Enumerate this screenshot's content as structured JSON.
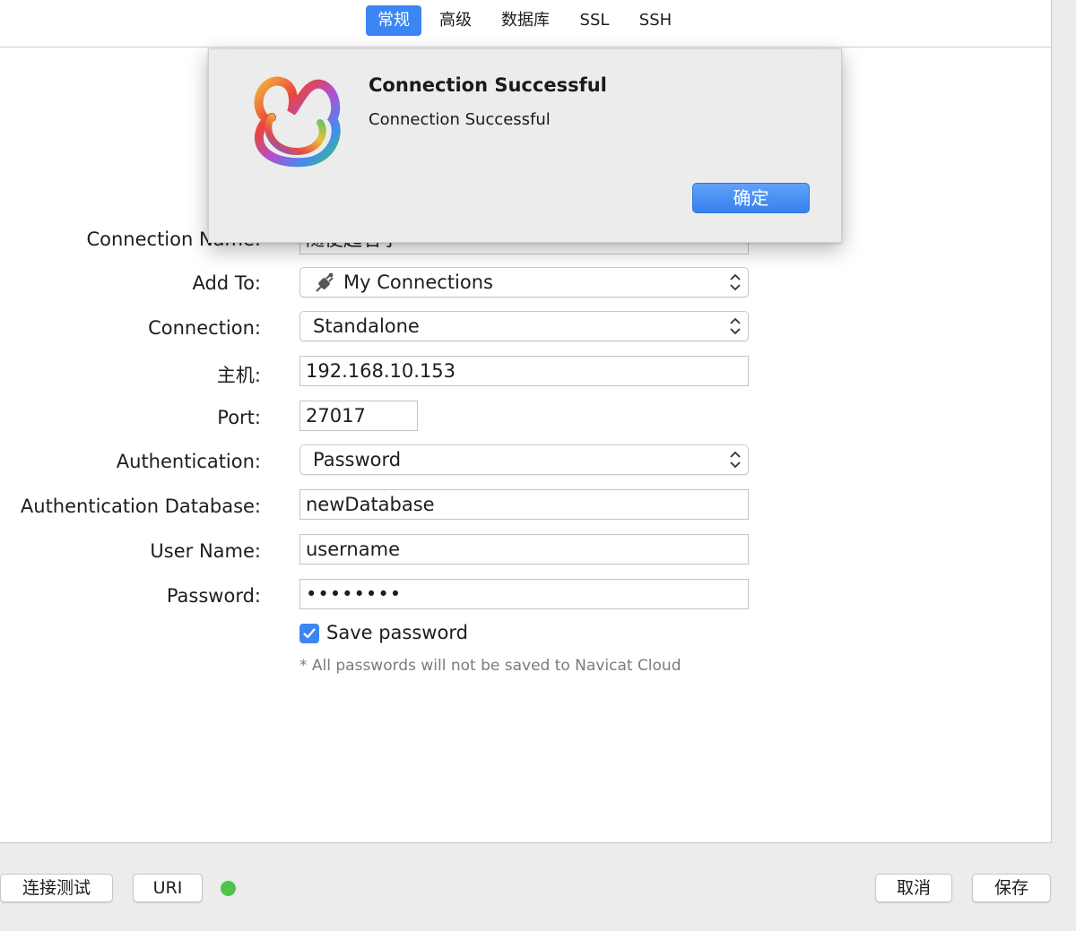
{
  "tabs": [
    {
      "label": "常规",
      "active": true
    },
    {
      "label": "高级",
      "active": false
    },
    {
      "label": "数据库",
      "active": false
    },
    {
      "label": "SSL",
      "active": false
    },
    {
      "label": "SSH",
      "active": false
    }
  ],
  "form": {
    "connection_name_label": "Connection Name:",
    "connection_name_value": "随便起名字",
    "add_to_label": "Add To:",
    "add_to_value": "My Connections",
    "connection_label": "Connection:",
    "connection_value": "Standalone",
    "host_label": "主机:",
    "host_value": "192.168.10.153",
    "port_label": "Port:",
    "port_value": "27017",
    "auth_label": "Authentication:",
    "auth_value": "Password",
    "auth_db_label": "Authentication Database:",
    "auth_db_value": "newDatabase",
    "username_label": "User Name:",
    "username_value": "username",
    "password_label": "Password:",
    "password_value": "••••••••",
    "save_password_label": "Save password",
    "save_password_checked": true,
    "cloud_note": "* All passwords will not be saved to Navicat Cloud"
  },
  "footer": {
    "test_button": "连接测试",
    "uri_button": "URI",
    "cancel_button": "取消",
    "save_button": "保存",
    "status_color": "#4fc44a"
  },
  "alert": {
    "title": "Connection Successful",
    "message": "Connection Successful",
    "ok_button": "确定",
    "icon": "navicat-logo-icon"
  },
  "colors": {
    "accent": "#3b86f5",
    "background": "#ececec"
  }
}
